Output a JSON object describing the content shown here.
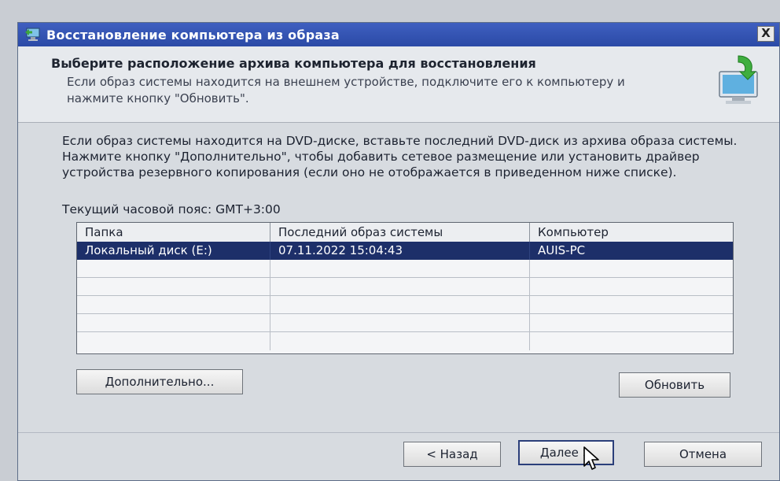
{
  "window": {
    "title": "Восстановление компьютера из образа",
    "close_label": "X"
  },
  "header": {
    "heading": "Выберите расположение архива компьютера для восстановления",
    "subtext": "Если образ системы находится на внешнем устройстве, подключите его к компьютеру и нажмите кнопку \"Обновить\"."
  },
  "main": {
    "description": "Если образ системы находится на DVD-диске, вставьте последний DVD-диск из архива образа системы. Нажмите кнопку \"Дополнительно\", чтобы добавить сетевое размещение или установить драйвер устройства резервного копирования (если оно не отображается в приведенном ниже списке).",
    "timezone": "Текущий часовой пояс: GMT+3:00"
  },
  "table": {
    "columns": [
      "Папка",
      "Последний образ системы",
      "Компьютер"
    ],
    "rows": [
      [
        "Локальный диск (E:)",
        "07.11.2022 15:04:43",
        "AUIS-PC"
      ]
    ]
  },
  "buttons": {
    "advanced": "Дополнительно...",
    "refresh": "Обновить",
    "back": "< Назад",
    "next": "Далее >",
    "cancel": "Отмена"
  }
}
